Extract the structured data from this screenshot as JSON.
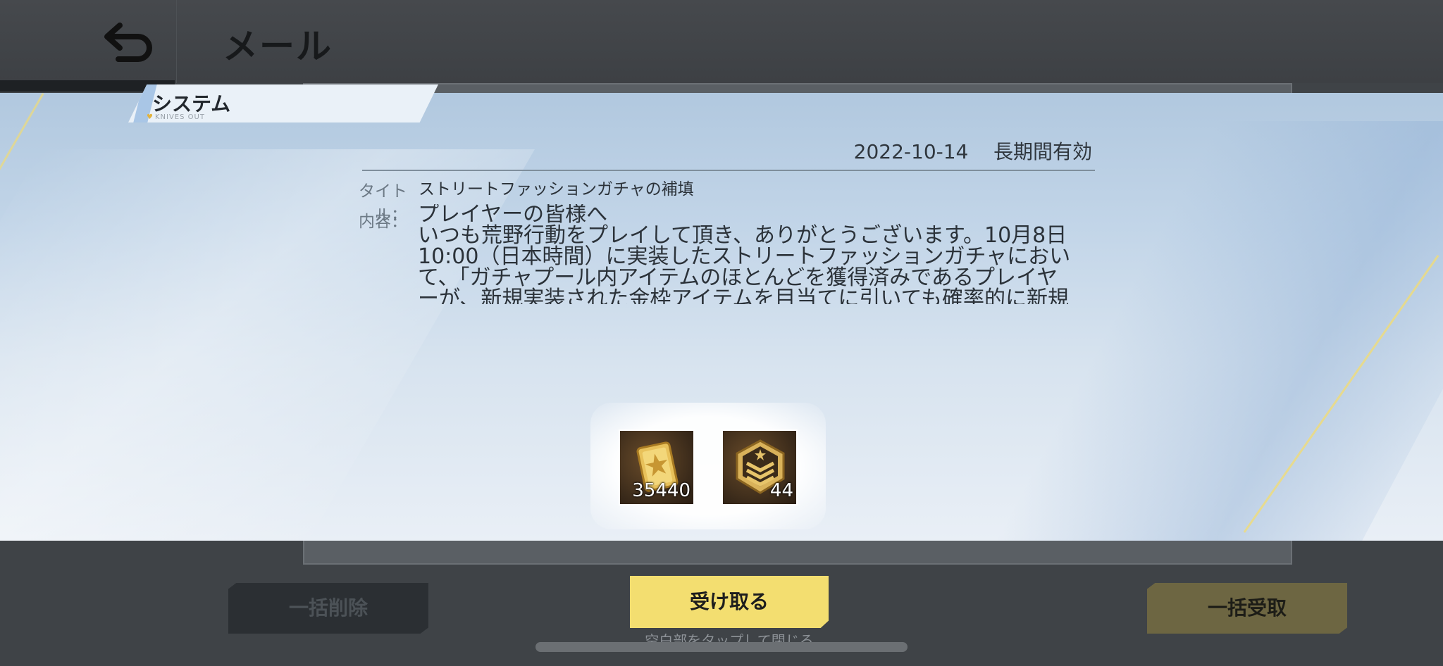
{
  "header": {
    "title": "メール",
    "back_icon": "back-arrow-icon"
  },
  "mail": {
    "category": "システム",
    "category_sub": "KNIVES OUT",
    "date": "2022-10-14",
    "validity": "長期間有効",
    "title_label": "タイトル：",
    "title": "ストリートファッションガチャの補填",
    "content_label": "内容：",
    "body_lines": [
      "プレイヤーの皆様へ",
      "いつも荒野行動をプレイして頂き、ありがとうございます。10月8日",
      "10:00（日本時間）に実装したストリートファッションガチャにおい",
      "て、「ガチャプール内アイテムのほとんどを獲得済みであるプレイヤ",
      "ーが、新規実装された金枠アイテムを目当てに引いても確率的に新規"
    ]
  },
  "rewards": [
    {
      "icon": "gold-voucher-icon",
      "quantity": "35440"
    },
    {
      "icon": "rank-badge-icon",
      "quantity": "44"
    }
  ],
  "buttons": {
    "delete_all": "一括削除",
    "receive": "受け取る",
    "receive_all": "一括受取"
  },
  "hint": "空白部をタップして閉じる",
  "colors": {
    "accent_yellow": "#f3de70",
    "modal_blue": "#b1c8df"
  }
}
